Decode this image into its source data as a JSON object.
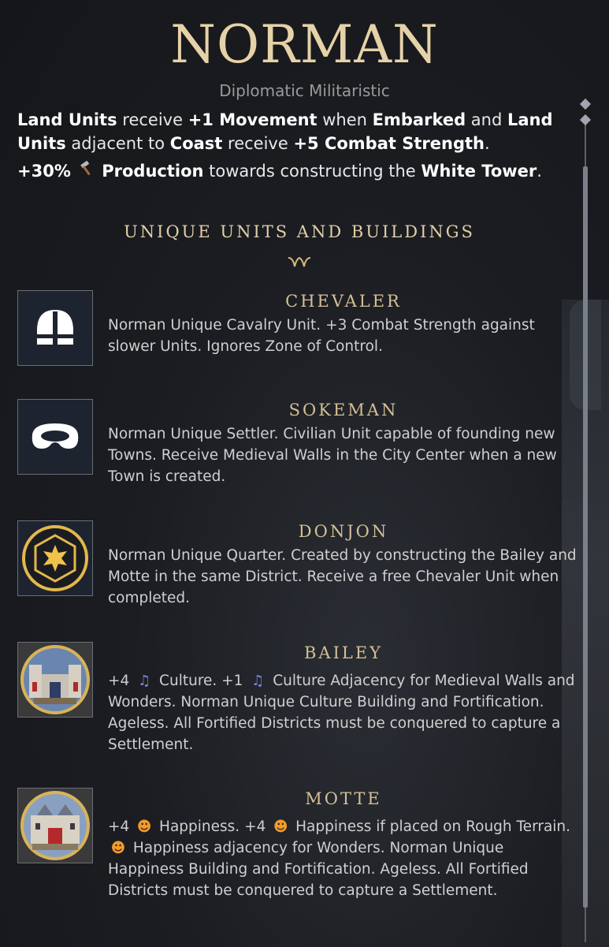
{
  "civ": {
    "name": "NORMAN",
    "traits": "Diplomatic Militaristic"
  },
  "ability": {
    "line1": {
      "p1": "Land Units",
      "p2": " receive ",
      "p3": "+1 Movement",
      "p4": " when ",
      "p5": "Embarked",
      "p6": " and ",
      "p7": "Land Units",
      "p8": " adjacent to ",
      "p9": "Coast",
      "p10": " receive ",
      "p11": "+5 Combat Strength",
      "p12": "."
    },
    "line2": {
      "p1": "+30%",
      "icon": "hammer-icon",
      "p2": "Production",
      "p3": " towards constructing the ",
      "p4": "White Tower",
      "p5": "."
    }
  },
  "section": {
    "header": "UNIQUE UNITS AND BUILDINGS"
  },
  "items": [
    {
      "name": "CHEVALER",
      "icon": "cavalry-helmet-icon",
      "desc": "Norman Unique Cavalry Unit. +3 Combat Strength against slower Units. Ignores Zone of Control."
    },
    {
      "name": "SOKEMAN",
      "icon": "settler-icon",
      "desc": "Norman Unique Settler. Civilian Unit capable of founding new Towns. Receive Medieval Walls in the City Center when a new Town is created."
    },
    {
      "name": "DONJON",
      "icon": "quarter-star-icon",
      "desc": "Norman Unique Quarter. Created by constructing the Bailey and Motte in the same District. Receive a free Chevaler Unit when completed."
    },
    {
      "name": "BAILEY",
      "icon": "bailey-building-icon",
      "desc_parts": {
        "a": "+4",
        "b": " Culture. +1",
        "c": " Culture Adjacency for Medieval Walls and Wonders. Norman Unique Culture Building and Fortification. Ageless. All Fortified Districts must be conquered to capture a Settlement."
      },
      "resource_icon": "culture-icon"
    },
    {
      "name": "MOTTE",
      "icon": "motte-building-icon",
      "desc_parts": {
        "a": "+4",
        "b": " Happiness. +4",
        "c": " Happiness if placed on Rough Terrain.",
        "d": " Happiness adjacency for Wonders. Norman Unique Happiness Building and Fortification. Ageless. All Fortified Districts must be conquered to capture a Settlement."
      },
      "resource_icon": "happiness-icon"
    }
  ],
  "colors": {
    "title": "#e6d2a8",
    "header": "#e2cfa7",
    "item_name": "#d5bf95",
    "culture": "#7d86e0",
    "happiness": "#f39a2a"
  }
}
